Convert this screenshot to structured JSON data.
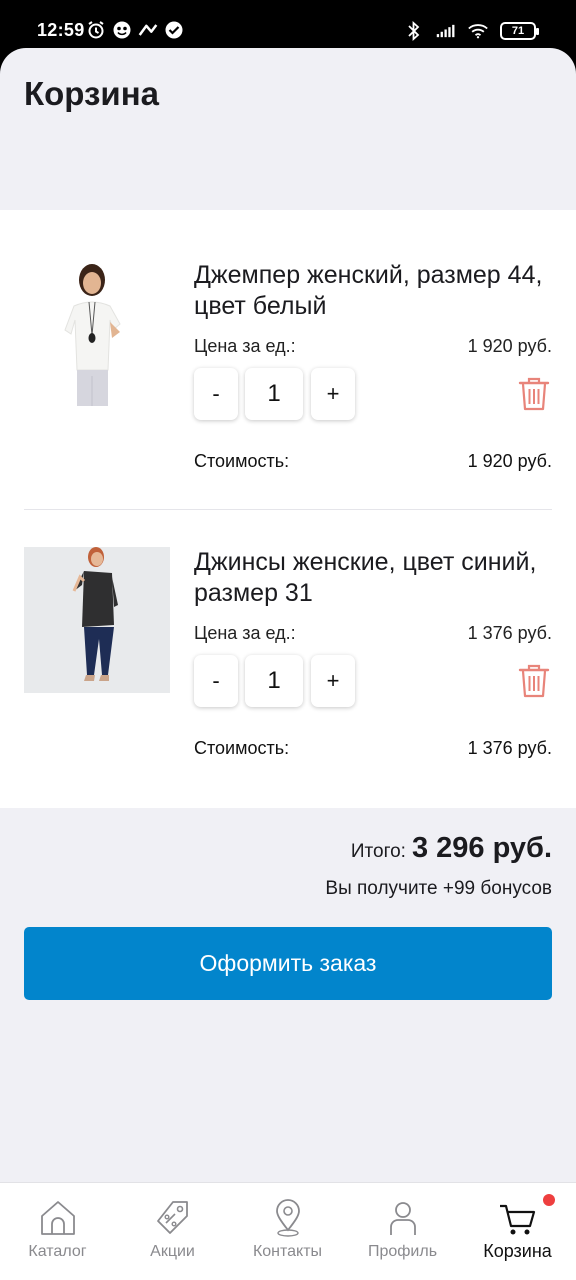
{
  "status_bar": {
    "time": "12:59",
    "battery": "71",
    "left_icons": [
      "alarm-icon",
      "face-icon",
      "route-icon",
      "check-circle-icon"
    ],
    "right_icons": [
      "bluetooth-icon",
      "signal-icon",
      "wifi-icon"
    ]
  },
  "header": {
    "title": "Корзина"
  },
  "cart": {
    "items": [
      {
        "name": "Джемпер женский, размер 44, цвет белый",
        "price_label": "Цена за ед.:",
        "price": "1 920 руб.",
        "minus_label": "-",
        "qty": "1",
        "plus_label": "+",
        "cost_label": "Стоимость:",
        "cost": "1 920 руб."
      },
      {
        "name": "Джинсы женские, цвет синий, размер 31",
        "price_label": "Цена за ед.:",
        "price": "1 376 руб.",
        "minus_label": "-",
        "qty": "1",
        "plus_label": "+",
        "cost_label": "Стоимость:",
        "cost": "1 376 руб."
      }
    ]
  },
  "summary": {
    "total_label": "Итого:",
    "total_value": "3 296 руб.",
    "bonus_text": "Вы получите +99 бонусов",
    "checkout_label": "Оформить заказ"
  },
  "tabbar": {
    "tabs": [
      {
        "label": "Каталог",
        "icon": "home-icon"
      },
      {
        "label": "Акции",
        "icon": "tag-icon"
      },
      {
        "label": "Контакты",
        "icon": "location-pin-icon"
      },
      {
        "label": "Профиль",
        "icon": "user-icon"
      },
      {
        "label": "Корзина",
        "icon": "cart-icon",
        "active": true
      }
    ]
  },
  "colors": {
    "accent": "#0285cc",
    "delete": "#e8847a",
    "badge": "#ee3f3f",
    "background": "#f0f0f5"
  }
}
